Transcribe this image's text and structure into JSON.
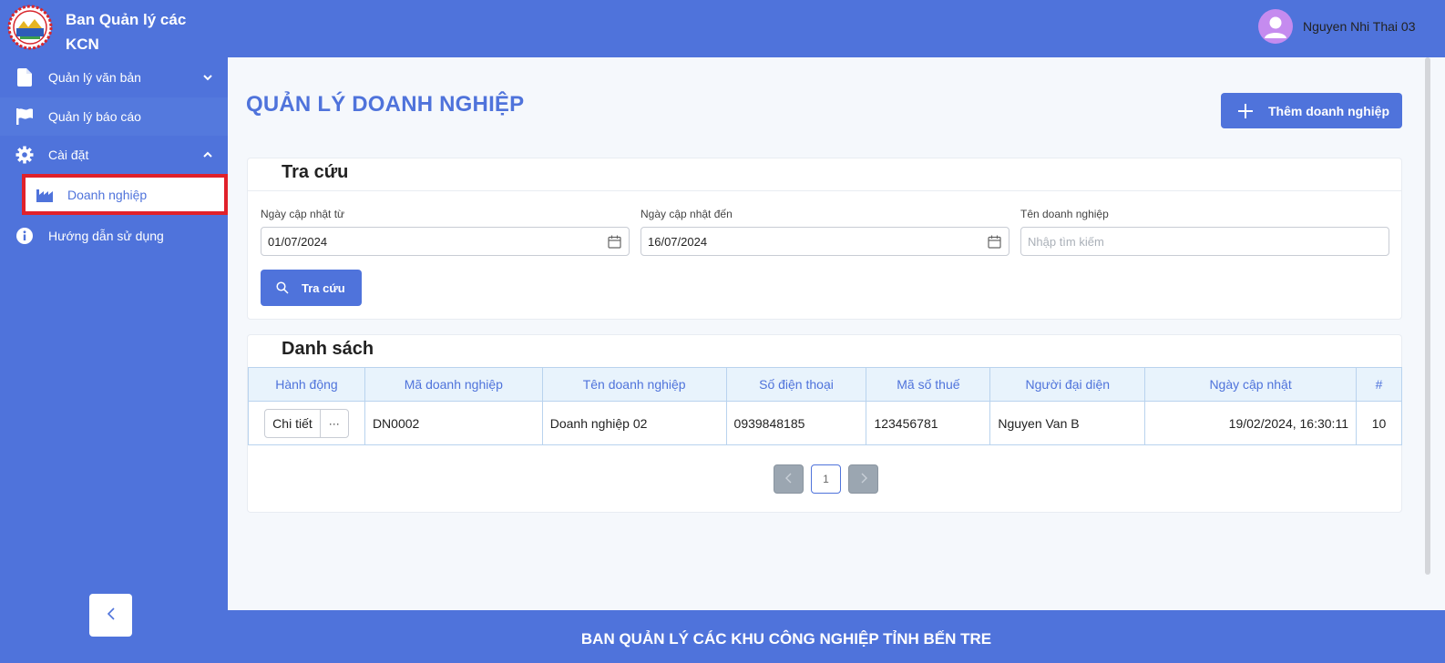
{
  "brand": {
    "title": "Ban Quản lý các KCN",
    "logo_icon": "industrial-zone-logo-icon"
  },
  "sidebar": {
    "items": [
      {
        "label": "Quản lý văn bản",
        "icon": "document-icon",
        "expandable": true,
        "expanded": false
      },
      {
        "label": "Quản lý báo cáo",
        "icon": "flag-icon",
        "expandable": false
      },
      {
        "label": "Cài đặt",
        "icon": "gear-icon",
        "expandable": true,
        "expanded": true
      },
      {
        "label": "Doanh nghiệp",
        "icon": "factory-icon",
        "selected": true,
        "highlight_color": "#e0212a"
      },
      {
        "label": "Hướng dẫn sử dụng",
        "icon": "info-icon",
        "expandable": false
      }
    ],
    "collapse_icon": "chevron-left-icon"
  },
  "header": {
    "user_name": "Nguyen Nhi Thai 03",
    "avatar_icon": "user-avatar-icon"
  },
  "page": {
    "title": "QUẢN LÝ DOANH NGHIỆP",
    "add_button_label": "Thêm doanh nghiệp"
  },
  "search": {
    "title": "Tra cứu",
    "from_label": "Ngày cập nhật từ",
    "from_value": "01/07/2024",
    "to_label": "Ngày cập nhật đến",
    "to_value": "16/07/2024",
    "name_label": "Tên doanh nghiệp",
    "name_placeholder": "Nhập tìm kiếm",
    "button_label": "Tra cứu"
  },
  "list": {
    "title": "Danh sách",
    "columns": [
      "Hành động",
      "Mã doanh nghiệp",
      "Tên doanh nghiệp",
      "Số điện thoại",
      "Mã số thuế",
      "Người đại diện",
      "Ngày cập nhật",
      "#"
    ],
    "rows": [
      {
        "action_label": "Chi tiết",
        "more_label": "···",
        "code": "DN0002",
        "name": "Doanh nghiệp 02",
        "phone": "0939848185",
        "tax": "123456781",
        "representative": "Nguyen Van B",
        "updated": "19/02/2024, 16:30:11",
        "index": "10"
      }
    ],
    "pagination": {
      "current_page": "1"
    }
  },
  "footer": {
    "text": "BAN QUẢN LÝ CÁC KHU CÔNG NGHIỆP TỈNH BẾN TRE"
  },
  "colors": {
    "primary": "#4f73db",
    "header_row": "#e8f3fc",
    "highlight": "#e0212a",
    "page_bg": "#f5f8fc"
  }
}
